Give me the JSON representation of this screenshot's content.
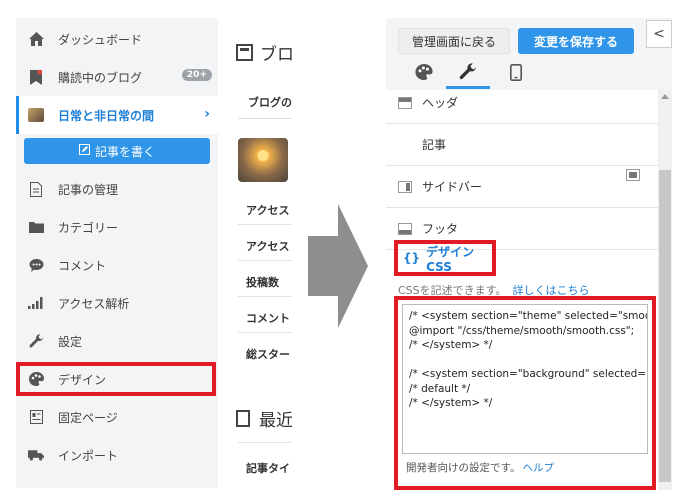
{
  "sidebar": {
    "items": [
      {
        "label": "ダッシュボード",
        "icon": "home-icon"
      },
      {
        "label": "購読中のブログ",
        "icon": "bookmark-icon",
        "badge": "20+"
      },
      {
        "label": "日常と非日常の間",
        "icon": "blog-avatar-icon"
      },
      {
        "label": "記事の管理",
        "icon": "document-icon"
      },
      {
        "label": "カテゴリー",
        "icon": "folder-icon"
      },
      {
        "label": "コメント",
        "icon": "comment-icon"
      },
      {
        "label": "アクセス解析",
        "icon": "bar-chart-icon"
      },
      {
        "label": "設定",
        "icon": "wrench-icon"
      },
      {
        "label": "デザイン",
        "icon": "palette-icon"
      },
      {
        "label": "固定ページ",
        "icon": "page-icon"
      },
      {
        "label": "インポート",
        "icon": "truck-icon"
      }
    ],
    "write_button": "記事を書く"
  },
  "middle": {
    "title": "ブロ",
    "tab": "ブログの",
    "rows": [
      "アクセス",
      "アクセス",
      "投稿数",
      "コメント",
      "総スター"
    ],
    "section2_title": "最近",
    "section2_row": "記事タイ"
  },
  "design": {
    "back_button": "管理画面に戻る",
    "save_button": "変更を保存する",
    "collapse_glyph": "<",
    "tabs": [
      {
        "icon": "palette-icon"
      },
      {
        "icon": "wrench-icon"
      },
      {
        "icon": "smartphone-icon"
      }
    ],
    "sections": [
      "ヘッダ",
      "記事",
      "サイドバー",
      "フッタ"
    ],
    "css_section": {
      "brace": "{}",
      "title": "デザインCSS",
      "description": "CSSを記述できます。",
      "details_link": "詳しくはこちら",
      "editor_content": "/* <system section=\"theme\" selected=\"smooth\">\n@import \"/css/theme/smooth/smooth.css\";\n/* </system> */\n\n/* <system section=\"background\" selected=\"default\">\n/* default */\n/* </system> */",
      "dev_note": "開発者向けの設定です。",
      "help_link": "ヘルプ"
    }
  },
  "colors": {
    "accent": "#2f95e8",
    "highlight": "#e01b24",
    "link": "#1f7fd6"
  }
}
